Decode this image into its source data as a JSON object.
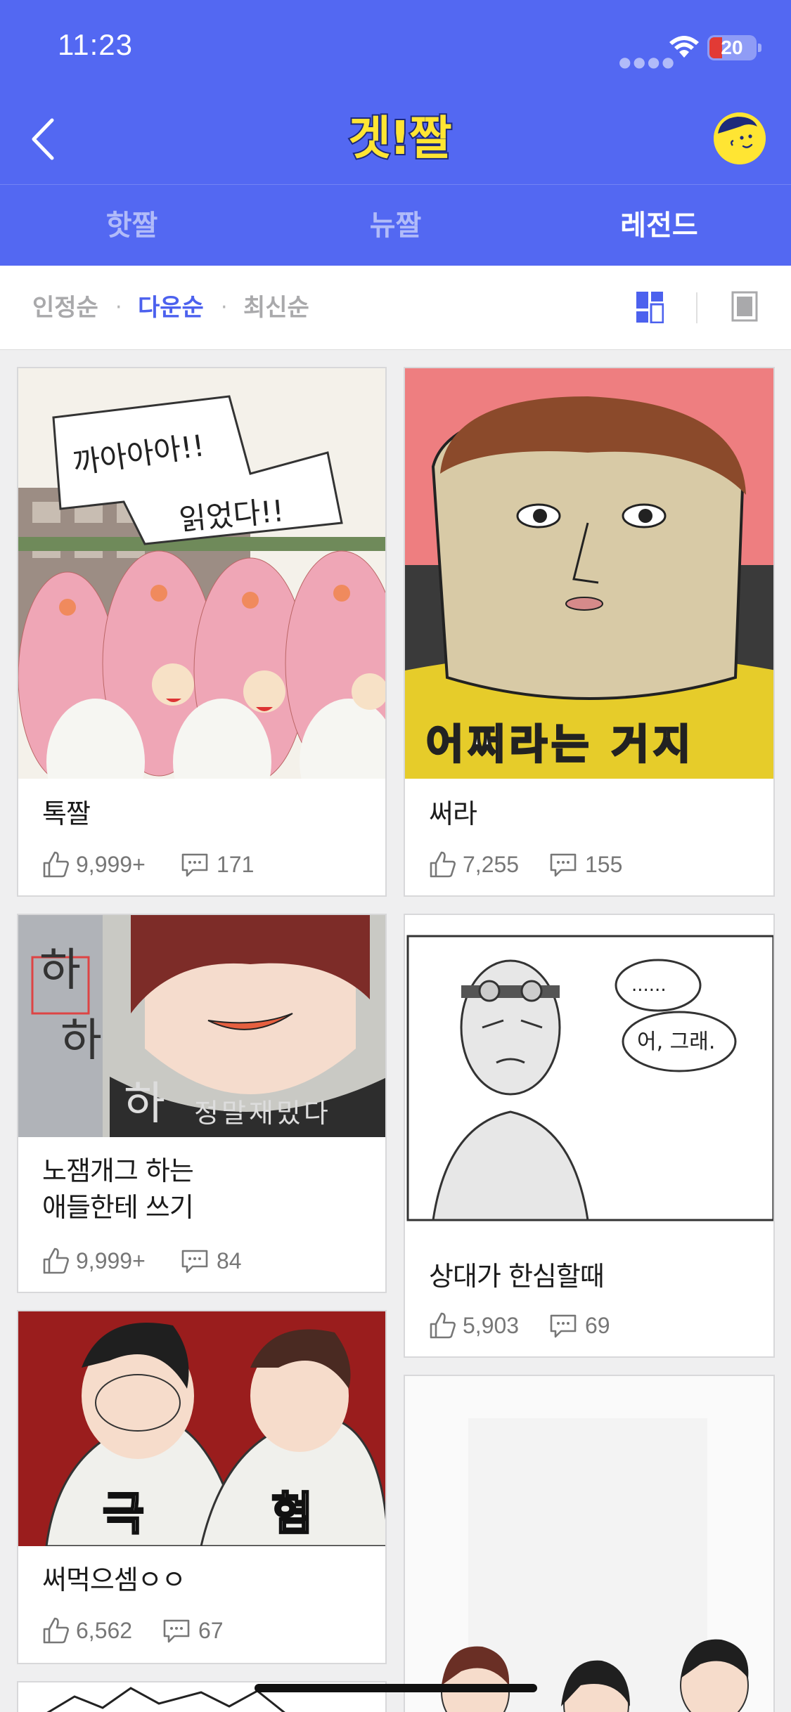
{
  "status_bar": {
    "time": "11:23",
    "battery": "20"
  },
  "header": {
    "logo_text": "겟!짤"
  },
  "tabs": [
    {
      "label": "핫짤",
      "active": false
    },
    {
      "label": "뉴짤",
      "active": false
    },
    {
      "label": "레전드",
      "active": true
    }
  ],
  "sort_options": [
    {
      "label": "인정순",
      "active": false
    },
    {
      "label": "다운순",
      "active": true
    },
    {
      "label": "최신순",
      "active": false
    }
  ],
  "sort_separator": "·",
  "cards": [
    {
      "title": "톡짤",
      "likes": "9,999+",
      "comments": "171",
      "image_text": [
        "까아아아!!",
        "읽었다!!"
      ]
    },
    {
      "title": "써라",
      "likes": "7,255",
      "comments": "155",
      "image_text": [
        "어쩌라는 거지"
      ]
    },
    {
      "title_lines": [
        "노잼개그 하는",
        "애들한테 쓰기"
      ],
      "likes": "9,999+",
      "comments": "84",
      "image_text": [
        "하",
        "하",
        "하",
        "정말재밌다"
      ]
    },
    {
      "title": "상대가 한심할때",
      "likes": "5,903",
      "comments": "69",
      "image_text": [
        "......",
        "어, 그래."
      ]
    },
    {
      "title": "써먹으셈ㅇㅇ",
      "likes": "6,562",
      "comments": "67",
      "image_text": [
        "극",
        "혐"
      ]
    }
  ],
  "colors": {
    "brand_blue": "#5368f2",
    "active_sort": "#4c61ee",
    "logo_yellow": "#ffe533"
  }
}
